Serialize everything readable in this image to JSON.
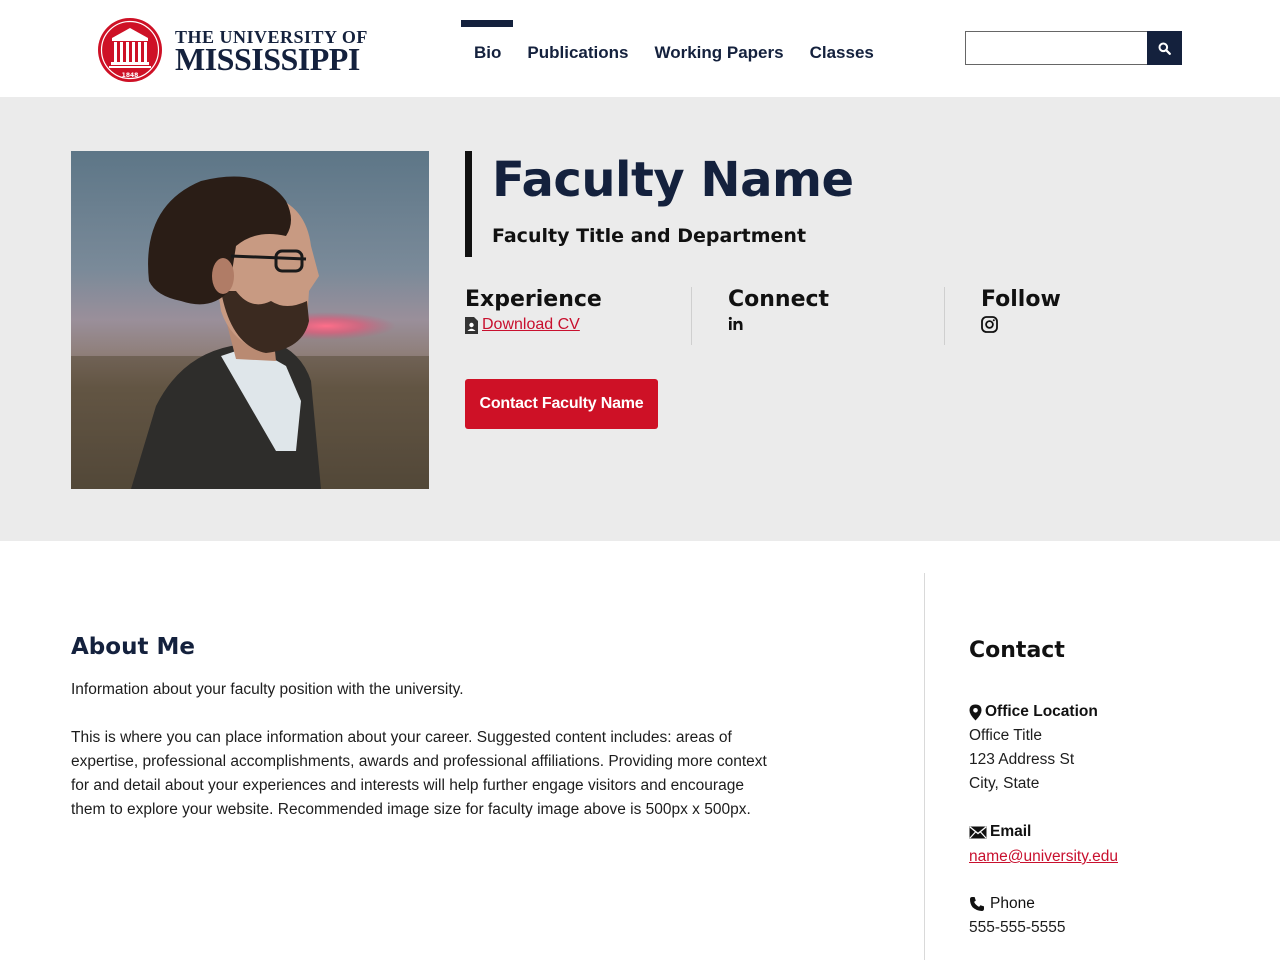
{
  "header": {
    "logo": {
      "line1": "THE UNIVERSITY OF",
      "line2": "MISSISSIPPI",
      "seal_year": "1848"
    },
    "nav": [
      {
        "label": "Bio",
        "active": true
      },
      {
        "label": "Publications",
        "active": false
      },
      {
        "label": "Working Papers",
        "active": false
      },
      {
        "label": "Classes",
        "active": false
      }
    ],
    "search": {
      "value": "",
      "placeholder": "",
      "icon": "search-icon"
    }
  },
  "hero": {
    "photo": "faculty-portrait",
    "name": "Faculty Name",
    "title": "Faculty Title and Department",
    "experience": {
      "heading": "Experience",
      "link_label": "Download CV",
      "icon": "document-icon"
    },
    "connect": {
      "heading": "Connect",
      "icon": "linkedin-icon"
    },
    "follow": {
      "heading": "Follow",
      "icon": "instagram-icon"
    },
    "contact_button": "Contact Faculty Name"
  },
  "about": {
    "heading": "About Me",
    "p1": "Information about your faculty position with the university.",
    "p2": "This is where you can place information about your career. Suggested content includes: areas of expertise, professional accomplishments, awards and professional affiliations. Providing more context for and detail about your experiences and interests will help further engage visitors and encourage them to explore your website. Recommended image size for faculty image above is 500px x 500px."
  },
  "contact": {
    "heading": "Contact",
    "office": {
      "label": "Office Location",
      "line1": "Office Title",
      "line2": "123 Address St",
      "line3": "City, State",
      "icon": "map-pin-icon"
    },
    "email": {
      "label": "Email",
      "value": "name@university.edu",
      "icon": "envelope-icon"
    },
    "phone": {
      "label": "Phone",
      "value": "555-555-5555",
      "icon": "phone-icon"
    }
  },
  "colors": {
    "navy": "#14213d",
    "red": "#ce1126",
    "hero_bg": "#ebebeb"
  }
}
